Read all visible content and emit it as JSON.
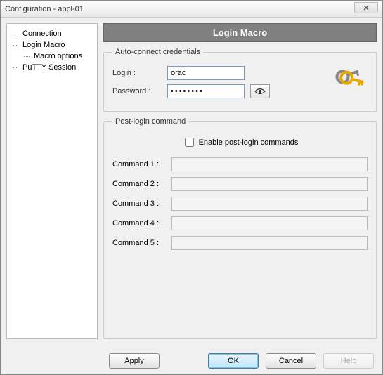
{
  "window": {
    "title": "Configuration - appl-01"
  },
  "tree": {
    "items": [
      {
        "label": "Connection"
      },
      {
        "label": "Login Macro"
      },
      {
        "label": "Macro options"
      },
      {
        "label": "PuTTY Session"
      }
    ]
  },
  "panel": {
    "title": "Login Macro",
    "auto": {
      "legend": "Auto-connect credentials",
      "login_label": "Login :",
      "login_value": "orac",
      "password_label": "Password :",
      "password_value": "••••••••"
    },
    "post": {
      "legend": "Post-login command",
      "enable_label": "Enable post-login commands",
      "enable_checked": false,
      "cmds": [
        {
          "label": "Command 1 :",
          "value": ""
        },
        {
          "label": "Command 2 :",
          "value": ""
        },
        {
          "label": "Command 3 :",
          "value": ""
        },
        {
          "label": "Command 4 :",
          "value": ""
        },
        {
          "label": "Command 5 :",
          "value": ""
        }
      ]
    }
  },
  "buttons": {
    "apply": "Apply",
    "ok": "OK",
    "cancel": "Cancel",
    "help": "Help"
  }
}
